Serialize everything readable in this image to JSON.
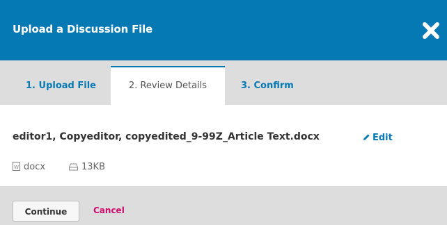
{
  "modal": {
    "title": "Upload a Discussion File",
    "close_icon": "close-x-icon"
  },
  "tabs": [
    {
      "label": "1. Upload File",
      "state": "link"
    },
    {
      "label": "2. Review Details",
      "state": "active"
    },
    {
      "label": "3. Confirm",
      "state": "link"
    }
  ],
  "file": {
    "name": "editor1, Copyeditor, copyedited_9-99Z_Article Text.docx",
    "edit_label": "Edit",
    "edit_icon": "pencil-icon",
    "type_label": "docx",
    "type_icon": "word-document-icon",
    "size_label": "13KB",
    "size_icon": "drive-icon"
  },
  "footer": {
    "continue_label": "Continue",
    "cancel_label": "Cancel"
  },
  "colors": {
    "header_bg": "#0579b3",
    "tab_bar_bg": "#dddddd",
    "link": "#0579b3",
    "cancel": "#d00a6c"
  }
}
